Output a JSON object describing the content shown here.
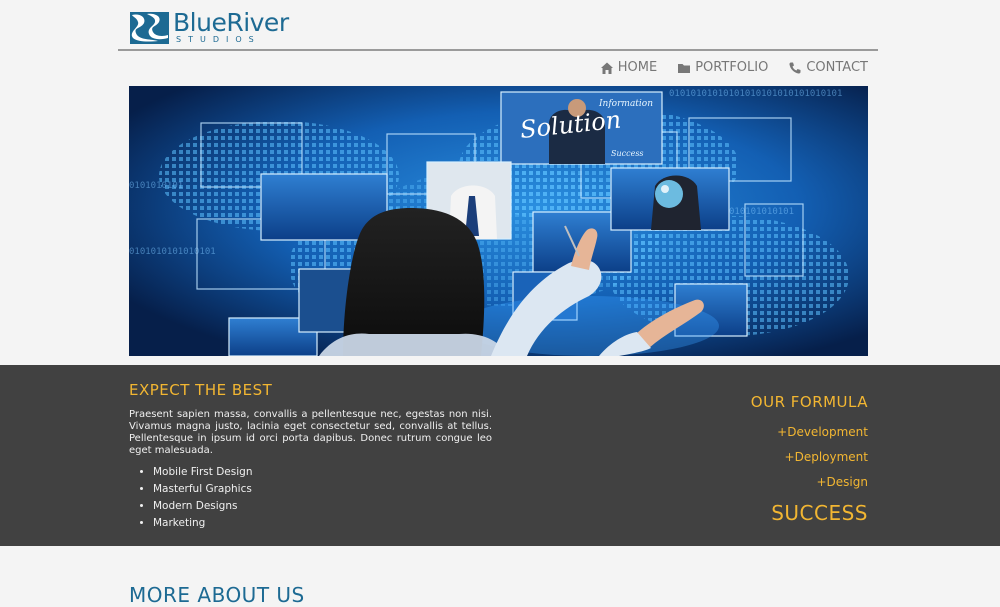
{
  "brand": {
    "name": "BlueRiver",
    "tagline": "STUDIOS",
    "color": "#1d6a93"
  },
  "nav": {
    "items": [
      {
        "label": "HOME",
        "icon": "home-icon"
      },
      {
        "label": "PORTFOLIO",
        "icon": "folder-icon"
      },
      {
        "label": "CONTACT",
        "icon": "phone-icon"
      }
    ]
  },
  "hero": {
    "image": "woman-touching-digital-screens",
    "overlay_text": [
      "Solution",
      "Information",
      "Success"
    ]
  },
  "expect": {
    "title": "EXPECT THE BEST",
    "body": "Praesent sapien massa, convallis a pellentesque nec, egestas non nisi. Vivamus magna justo, lacinia eget consectetur sed, convallis at tellus. Pellentesque in ipsum id orci porta dapibus. Donec rutrum congue leo eget malesuada.",
    "features": [
      "Mobile First Design",
      "Masterful Graphics",
      "Modern Designs",
      "Marketing"
    ]
  },
  "formula": {
    "title": "OUR FORMULA",
    "items": [
      "+Development",
      "+Deployment",
      "+Design"
    ],
    "result": "SUCCESS"
  },
  "more": {
    "title": "MORE ABOUT US"
  },
  "colors": {
    "accent": "#f2b632",
    "band": "#414141",
    "page": "#f4f4f4"
  }
}
